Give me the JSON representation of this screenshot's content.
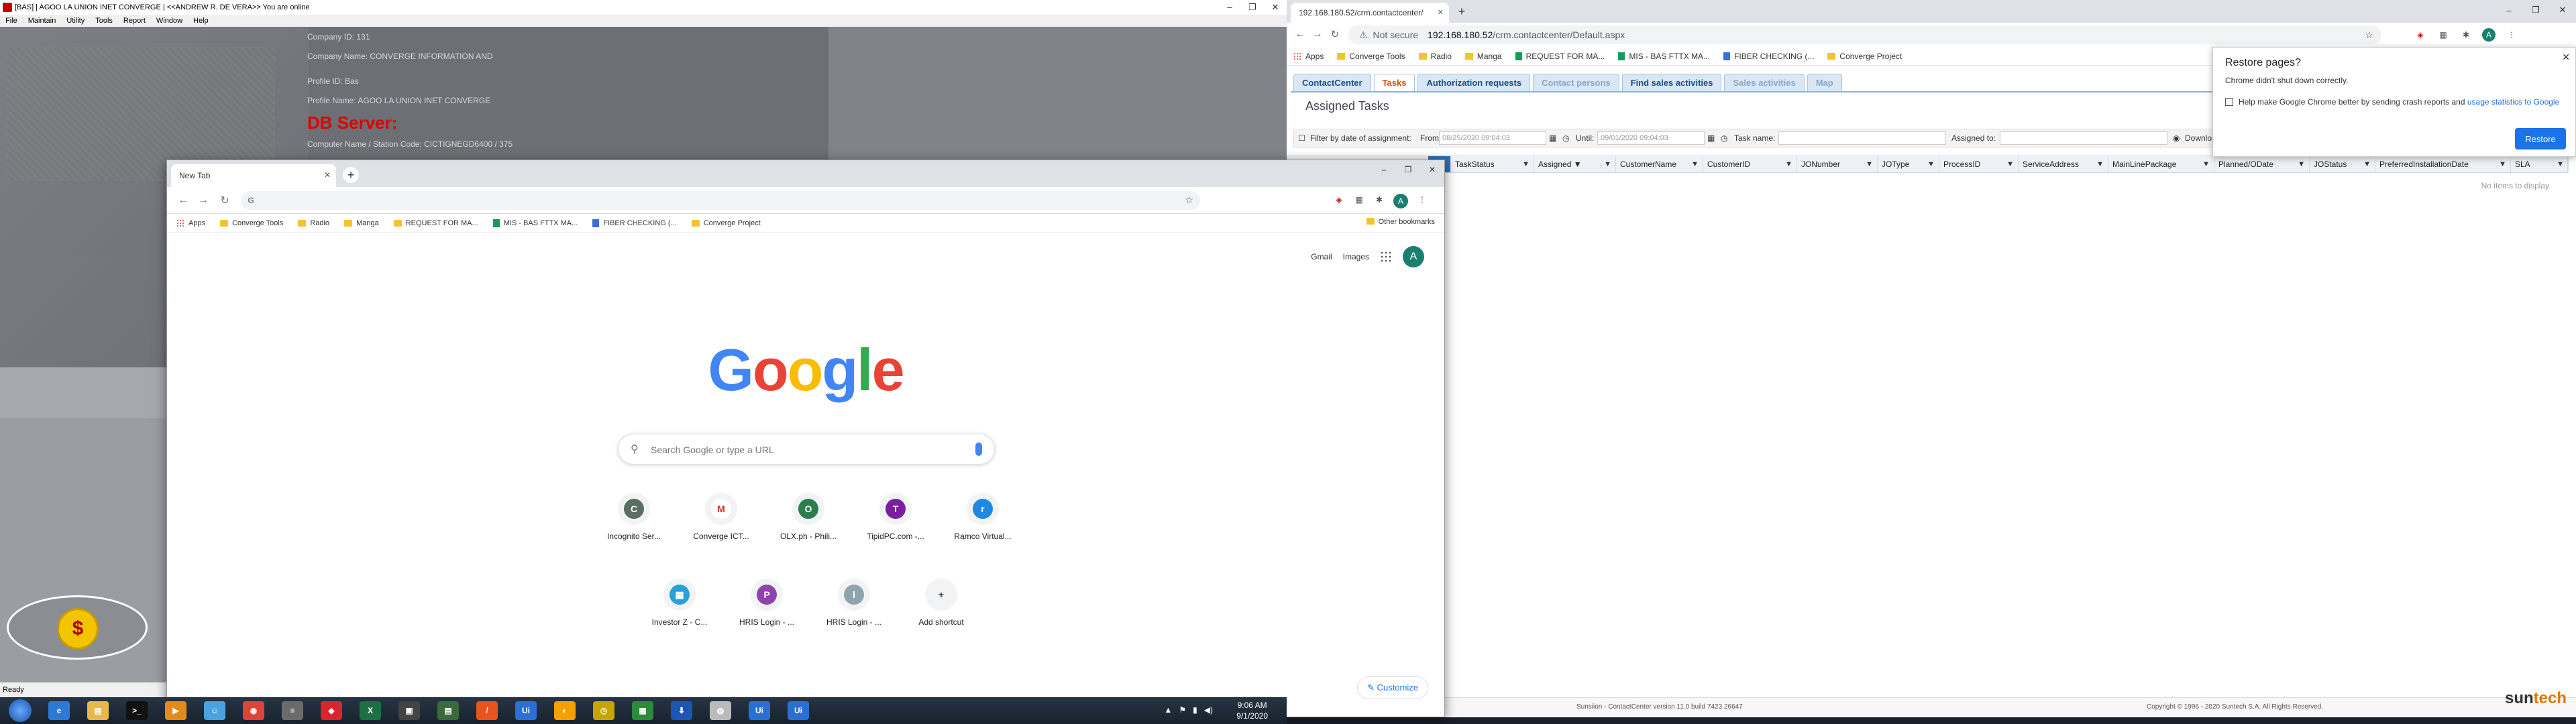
{
  "legacy": {
    "title": "[BAS] | AGOO LA UNION INET CONVERGE | <<ANDREW R. DE VERA>> You are online",
    "menu": [
      "File",
      "Maintain",
      "Utility",
      "Tools",
      "Report",
      "Window",
      "Help"
    ],
    "info": {
      "company_id": "Company ID: 131",
      "company_name": "Company Name: CONVERGE INFORMATION AND",
      "profile_id": "Profile ID: Bas",
      "profile_name": "Profile Name: AGOO LA UNION INET CONVERGE",
      "db_server": "DB Server:",
      "computer_name": "Computer Name / Station Code: CICTIGNEGD6400 / 375"
    },
    "status": "Ready"
  },
  "newtab": {
    "tab_title": "New Tab",
    "bookmarks": [
      {
        "label": "Apps",
        "icon": "apps"
      },
      {
        "label": "Converge Tools",
        "icon": "folder"
      },
      {
        "label": "Radio",
        "icon": "folder"
      },
      {
        "label": "Manga",
        "icon": "folder"
      },
      {
        "label": "REQUEST FOR MA...",
        "icon": "folder"
      },
      {
        "label": "MIS - BAS FTTX MA...",
        "icon": "sheet"
      },
      {
        "label": "FIBER CHECKING (...",
        "icon": "doc"
      },
      {
        "label": "Converge Project",
        "icon": "folder"
      }
    ],
    "other_bookmarks": "Other bookmarks",
    "gmail": "Gmail",
    "images": "Images",
    "avatar_letter": "A",
    "search_placeholder": "Search Google or type a URL",
    "shortcuts_row1": [
      {
        "label": "Incognito Ser...",
        "letter": "C",
        "color": "#5a6e62"
      },
      {
        "label": "Converge ICT...",
        "letter": "M",
        "color": "#ffffff"
      },
      {
        "label": "OLX.ph - Phili...",
        "letter": "O",
        "color": "#2e7d4f"
      },
      {
        "label": "TipidPC.com -...",
        "letter": "T",
        "color": "#7b1fa2"
      },
      {
        "label": "Ramco Virtual...",
        "letter": "r",
        "color": "#1e88e5"
      }
    ],
    "shortcuts_row2": [
      {
        "label": "Investor Z - C...",
        "letter": "▦",
        "color": "#2aa0d8"
      },
      {
        "label": "HRIS Login - ...",
        "letter": "P",
        "color": "#8e44ad"
      },
      {
        "label": "HRIS Login - ...",
        "letter": "l",
        "color": "#90a4ae"
      },
      {
        "label": "Add shortcut",
        "letter": "+",
        "color": "#f1f3f4"
      }
    ],
    "customize": "Customize"
  },
  "cc": {
    "tab_title": "192.168.180.52/crm.contactcenter/",
    "url_host": "192.168.180.52",
    "url_path": "/crm.contactcenter/Default.aspx",
    "not_secure": "Not secure",
    "bookmarks": [
      {
        "label": "Apps",
        "icon": "apps"
      },
      {
        "label": "Converge Tools",
        "icon": "folder"
      },
      {
        "label": "Radio",
        "icon": "folder"
      },
      {
        "label": "Manga",
        "icon": "folder"
      },
      {
        "label": "REQUEST FOR MA...",
        "icon": "sheet"
      },
      {
        "label": "MIS - BAS FTTX MA...",
        "icon": "sheet"
      },
      {
        "label": "FIBER CHECKING (...",
        "icon": "doc"
      },
      {
        "label": "Converge Project",
        "icon": "folder"
      }
    ],
    "app_tabs": [
      {
        "label": "ContactCenter",
        "state": "normal"
      },
      {
        "label": "Tasks",
        "state": "active"
      },
      {
        "label": "Authorization requests",
        "state": "normal"
      },
      {
        "label": "Contact persons",
        "state": "dim"
      },
      {
        "label": "Find sales activities",
        "state": "normal"
      },
      {
        "label": "Sales activities",
        "state": "dim"
      },
      {
        "label": "Map",
        "state": "dim"
      }
    ],
    "heading": "Assigned Tasks",
    "filter": {
      "by_date": "Filter by date of assignment:",
      "from": "From:",
      "from_val": "08/25/2020 09:04:03",
      "until": "Until:",
      "until_val": "09/01/2020 09:04:03",
      "task_name": "Task name:",
      "assigned_to": "Assigned to:",
      "download": "Downloa"
    },
    "columns": [
      "TaskStatus",
      "Assigned ▼",
      "CustomerName",
      "CustomerID",
      "JONumber",
      "JOType",
      "ProcessID",
      "ServiceAddress",
      "MainLinePackage",
      "Planned/ODate",
      "JOStatus",
      "PreferredInstallationDate",
      "SLA"
    ],
    "no_items": "No items to display",
    "footer_version": "Sunsiion - ContactCenter version 11.0 build 7423.26647",
    "footer_copy": "Copyright © 1996 - 2020 Suntech S.A. All Rights Reserved.",
    "brand_a": "sun",
    "brand_b": "tech",
    "restore": {
      "title": "Restore pages?",
      "body": "Chrome didn't shut down correctly.",
      "check_text": "Help make Google Chrome better by sending crash reports and ",
      "check_link": "usage statistics to Google",
      "button": "Restore"
    }
  },
  "taskbar": {
    "time": "9:06 AM",
    "date": "9/1/2020",
    "apps": [
      {
        "name": "ie",
        "label": "e",
        "color": "#2b7bd6"
      },
      {
        "name": "explorer",
        "label": "▤",
        "color": "#e8b84a"
      },
      {
        "name": "cmd",
        "label": ">_",
        "color": "#111"
      },
      {
        "name": "media",
        "label": "▶",
        "color": "#e38b1a"
      },
      {
        "name": "messenger",
        "label": "☺",
        "color": "#4aa3df"
      },
      {
        "name": "chrome",
        "label": "◉",
        "color": "#db4437"
      },
      {
        "name": "app1",
        "label": "≡",
        "color": "#6b6b6b"
      },
      {
        "name": "anydesk",
        "label": "◆",
        "color": "#d7262e"
      },
      {
        "name": "excel",
        "label": "X",
        "color": "#1d7044"
      },
      {
        "name": "app2",
        "label": "▣",
        "color": "#444"
      },
      {
        "name": "app3",
        "label": "▤",
        "color": "#3a6b3a"
      },
      {
        "name": "app4",
        "label": "/",
        "color": "#e8541c"
      },
      {
        "name": "uipath1",
        "label": "Ui",
        "color": "#2a6fd6"
      },
      {
        "name": "app5",
        "label": "◐",
        "color": "#f4a100"
      },
      {
        "name": "app6",
        "label": "◷",
        "color": "#c7a500"
      },
      {
        "name": "app7",
        "label": "▦",
        "color": "#2a8b3a"
      },
      {
        "name": "app8",
        "label": "⬇",
        "color": "#1b56b5"
      },
      {
        "name": "app9",
        "label": "◍",
        "color": "#bbbbbb"
      },
      {
        "name": "uipath2",
        "label": "Ui",
        "color": "#2a6fd6"
      },
      {
        "name": "uipath3",
        "label": "Ui",
        "color": "#2a6fd6"
      }
    ]
  }
}
